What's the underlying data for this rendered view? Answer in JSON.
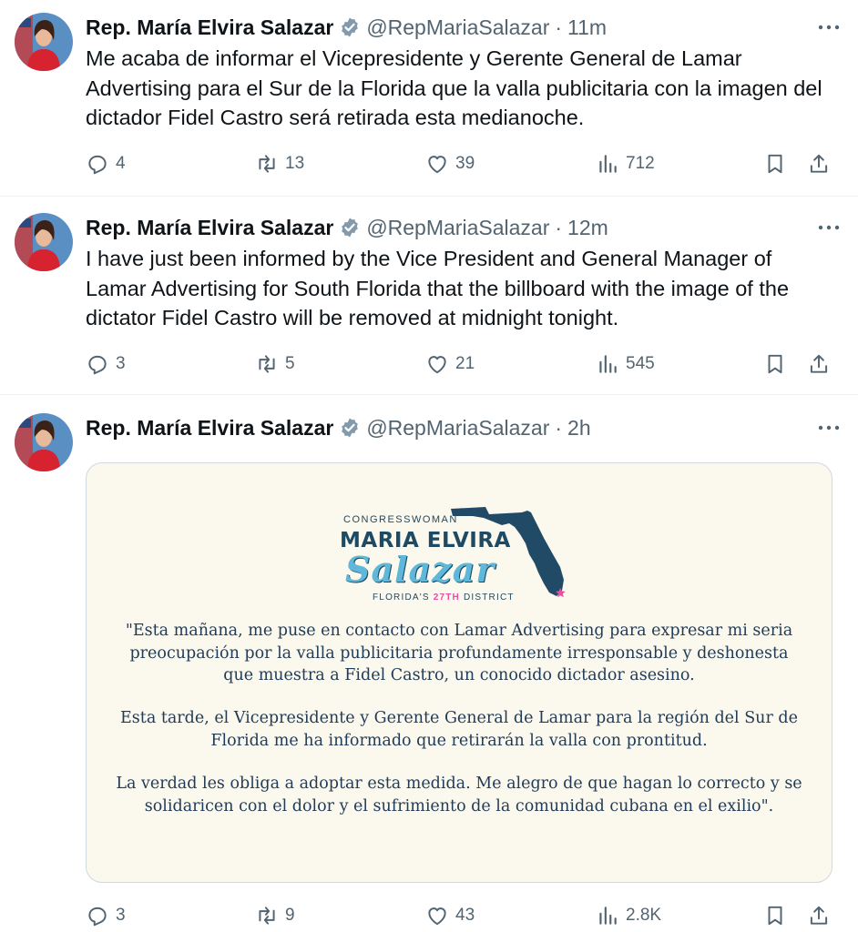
{
  "tweets": [
    {
      "author_name": "Rep. María Elvira Salazar",
      "handle": "@RepMariaSalazar",
      "separator": "·",
      "time": "11m",
      "text": "Me acaba de informar el Vicepresidente y Gerente General de Lamar Advertising para el Sur de la Florida que la valla publicitaria con la imagen del dictador Fidel Castro será retirada esta medianoche.",
      "replies": "4",
      "retweets": "13",
      "likes": "39",
      "views": "712"
    },
    {
      "author_name": "Rep. María Elvira Salazar",
      "handle": "@RepMariaSalazar",
      "separator": "·",
      "time": "12m",
      "text": "I have just been informed by the Vice President and General Manager of Lamar Advertising for South Florida that the billboard with the image of the dictator Fidel Castro will be removed at midnight tonight.",
      "replies": "3",
      "retweets": "5",
      "likes": "21",
      "views": "545"
    },
    {
      "author_name": "Rep. María Elvira Salazar",
      "handle": "@RepMariaSalazar",
      "separator": "·",
      "time": "2h",
      "replies": "3",
      "retweets": "9",
      "likes": "43",
      "views": "2.8K",
      "image": {
        "logo_top": "CONGRESSWOMAN",
        "logo_name": "MARIA ELVIRA",
        "logo_script": "Salazar",
        "logo_district_prefix": "FLORIDA'S",
        "logo_district_number": "27TH",
        "logo_district_suffix": "DISTRICT",
        "paragraph_1": "\"Esta mañana, me puse en contacto con Lamar Advertising para expresar mi seria preocupación por la valla publicitaria profundamente irresponsable y deshonesta que muestra a Fidel Castro, un conocido dictador asesino.",
        "paragraph_2": "Esta tarde, el Vicepresidente y Gerente General de Lamar para la región del Sur de Florida me ha informado que retirarán la valla con prontitud.",
        "paragraph_3": "La verdad les obliga a adoptar esta medida. Me alegro de que hagan lo correcto y se solidaricen con el dolor y el sufrimiento de la comunidad cubana en el exilio\"."
      }
    }
  ],
  "icons": {
    "reply": "reply-icon",
    "retweet": "retweet-icon",
    "like": "heart-icon",
    "views": "views-icon",
    "bookmark": "bookmark-icon",
    "share": "share-icon",
    "more": "more-icon",
    "verified": "verified-badge-icon"
  },
  "colors": {
    "text": "#0f1419",
    "secondary": "#536471",
    "verified_badge": "#829aab",
    "card_background": "#fbf8ee",
    "logo_navy": "#1f4a63",
    "logo_script": "#5fb8d9",
    "logo_pink": "#e84f9f"
  }
}
